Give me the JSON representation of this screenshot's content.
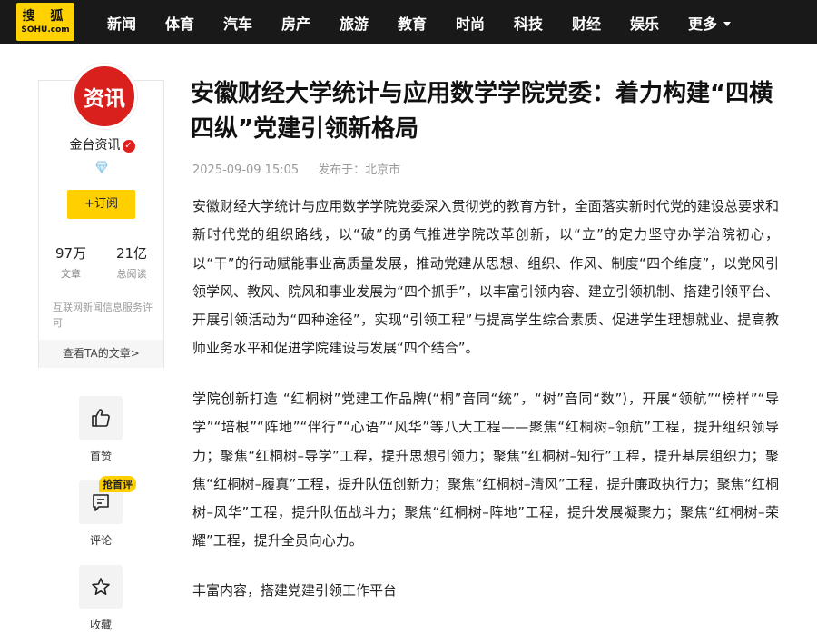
{
  "logo": {
    "line1": "搜 狐",
    "line2": "SOHU.com"
  },
  "nav": {
    "items": [
      "新闻",
      "体育",
      "汽车",
      "房产",
      "旅游",
      "教育",
      "时尚",
      "科技",
      "财经",
      "娱乐"
    ],
    "more": "更多"
  },
  "author": {
    "avatar_text": "资讯",
    "name": "金台资讯",
    "verified_mark": "✓",
    "follow_label": "+订阅",
    "stats": [
      {
        "value": "97万",
        "label": "文章"
      },
      {
        "value": "21亿",
        "label": "总阅读"
      }
    ],
    "license": "互联网新闻信息服务许可",
    "view_articles": "查看TA的文章>"
  },
  "actions": {
    "like": "首赞",
    "comment": "评论",
    "comment_badge": "抢首评",
    "favorite": "收藏"
  },
  "article": {
    "title": "安徽财经大学统计与应用数学学院党委：着力构建“四横四纵”党建引领新格局",
    "date": "2025-09-09 15:05",
    "published_in": "发布于：北京市",
    "paragraphs": [
      "安徽财经大学统计与应用数学学院党委深入贯彻党的教育方针，全面落实新时代党的建设总要求和新时代党的组织路线，以“破”的勇气推进学院改革创新，以“立”的定力坚守办学治院初心，以“干”的行动赋能事业高质量发展，推动党建从思想、组织、作风、制度“四个维度”，以党风引领学风、教风、院风和事业发展为“四个抓手”，以丰富引领内容、建立引领机制、搭建引领平台、开展引领活动为“四种途径”，实现“引领工程”与提高学生综合素质、促进学生理想就业、提高教师业务水平和促进学院建设与发展“四个结合”。",
      "学院创新打造 “红桐树”党建工作品牌(“桐”音同“统”，“树”音同“数”)，开展“领航”“榜样”“导学”“培根”“阵地”“伴行”“心语”“风华”等八大工程——聚焦“红桐树–领航”工程，提升组织领导力；聚焦“红桐树–导学”工程，提升思想引领力；聚焦“红桐树–知行”工程，提升基层组织力；聚焦“红桐树–履真”工程，提升队伍创新力；聚焦“红桐树–清风”工程，提升廉政执行力；聚焦“红桐树–风华”工程，提升队伍战斗力；聚焦“红桐树–阵地”工程，提升发展凝聚力；聚焦“红桐树–荣耀”工程，提升全员向心力。",
      "丰富内容，搭建党建引领工作平台"
    ]
  },
  "colors": {
    "accent": "#ffd200",
    "nav_bg": "#191919",
    "avatar_bg": "#d9201d"
  }
}
